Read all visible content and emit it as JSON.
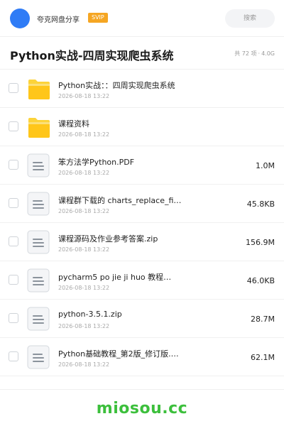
{
  "header": {
    "username": "夸克网盘分享",
    "badge": "SVIP",
    "search_placeholder": "搜索",
    "colors": {
      "avatar": "#2f7cf6",
      "badge": "#f5a623"
    }
  },
  "folder": {
    "title": "Python实战-四周实现爬虫系统",
    "item_count": "共 72 项",
    "total_size": "4.0G"
  },
  "files": [
    {
      "icon": "folder-icon",
      "name": "Python实战：：四周实现爬虫系统",
      "date": "2026-08-18 13:22",
      "size": ""
    },
    {
      "icon": "folder-icon",
      "name": "课程资料",
      "date": "2026-08-18 13:22",
      "size": ""
    },
    {
      "icon": "document-icon",
      "name": "笨方法学Python.PDF",
      "date": "2026-08-18 13:22",
      "size": "1.0M"
    },
    {
      "icon": "document-icon",
      "name": "课程群下载的 charts_replace_fil…",
      "date": "2026-08-18 13:22",
      "size": "45.8KB"
    },
    {
      "icon": "document-icon",
      "name": "课程源码及作业参考答案.zip",
      "date": "2026-08-18 13:22",
      "size": "156.9M"
    },
    {
      "icon": "document-icon",
      "name": "pycharm5 po jie ji huo 教程…",
      "date": "2026-08-18 13:22",
      "size": "46.0KB"
    },
    {
      "icon": "document-icon",
      "name": "python-3.5.1.zip",
      "date": "2026-08-18 13:22",
      "size": "28.7M"
    },
    {
      "icon": "document-icon",
      "name": "Python基础教程_第2版_修订版.pdf",
      "date": "2026-08-18 13:22",
      "size": "62.1M"
    }
  ],
  "footer": {
    "brand": "miosou.cc",
    "brand_color": "#3cbf3c"
  }
}
